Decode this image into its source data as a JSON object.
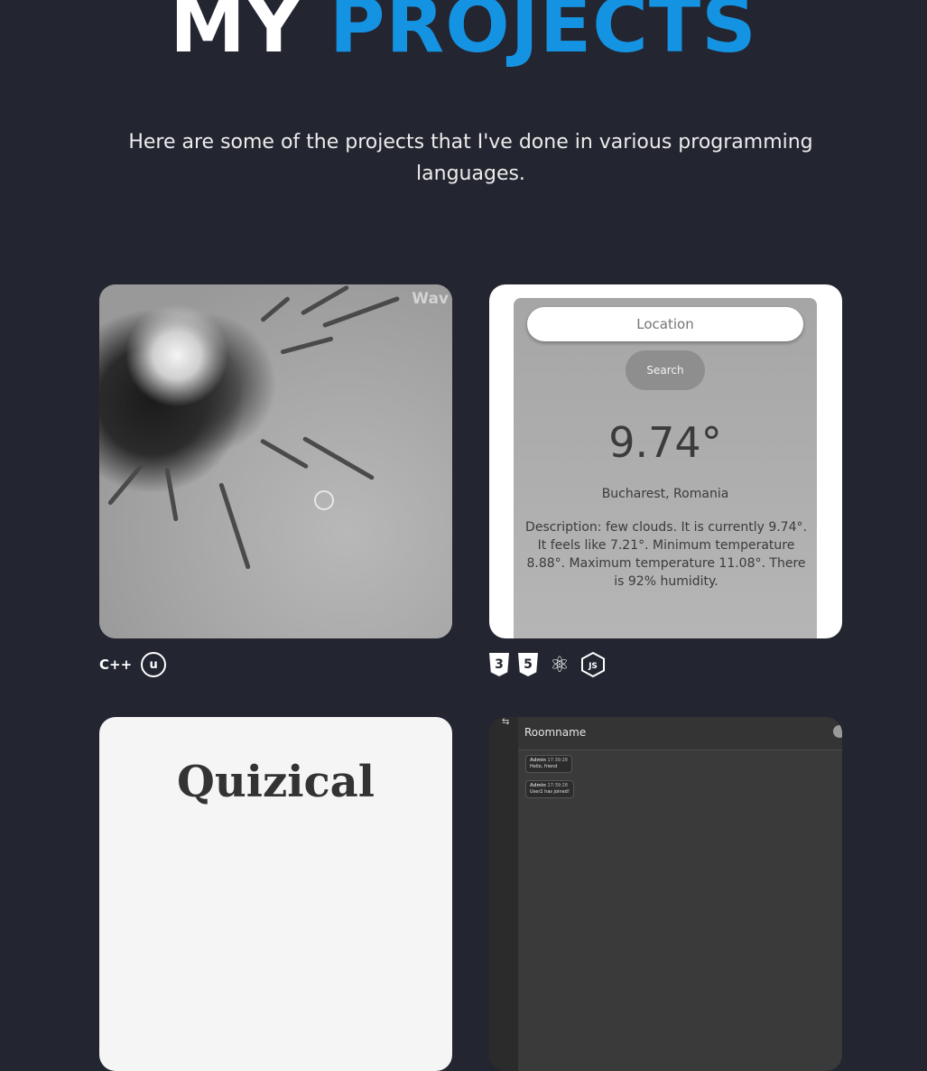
{
  "header": {
    "title_first": "MY",
    "title_accent": "PROJECTS",
    "accent_color": "#1593e3",
    "subtitle": "Here are some of the projects that I've done in various programming languages."
  },
  "projects": [
    {
      "watermark": "Wav",
      "techs": [
        {
          "icon": "cplusplus-icon",
          "label": "C++"
        },
        {
          "icon": "unreal-engine-icon",
          "label": "u"
        }
      ]
    },
    {
      "weather": {
        "location_placeholder": "Location",
        "search_label": "Search",
        "temperature": "9.74°",
        "city": "Bucharest, Romania",
        "description": "Description: few clouds. It is currently 9.74°. It feels like 7.21°. Minimum temperature 8.88°. Maximum temperature 11.08°. There is 92% humidity."
      },
      "techs": [
        {
          "icon": "css3-icon",
          "label": "3"
        },
        {
          "icon": "html5-icon",
          "label": "5"
        },
        {
          "icon": "react-icon",
          "label": "⚛"
        },
        {
          "icon": "nodejs-icon",
          "label": "JS"
        }
      ]
    },
    {
      "quiz_title": "Quizical"
    },
    {
      "chat": {
        "sidebar_icon": "⇆",
        "room_name": "Roomname",
        "messages": [
          {
            "author": "Admin",
            "time": "17:39:28",
            "text": "Hello, friend"
          },
          {
            "author": "Admin",
            "time": "17:39:28",
            "text": "User2 has joined!"
          }
        ]
      }
    }
  ]
}
